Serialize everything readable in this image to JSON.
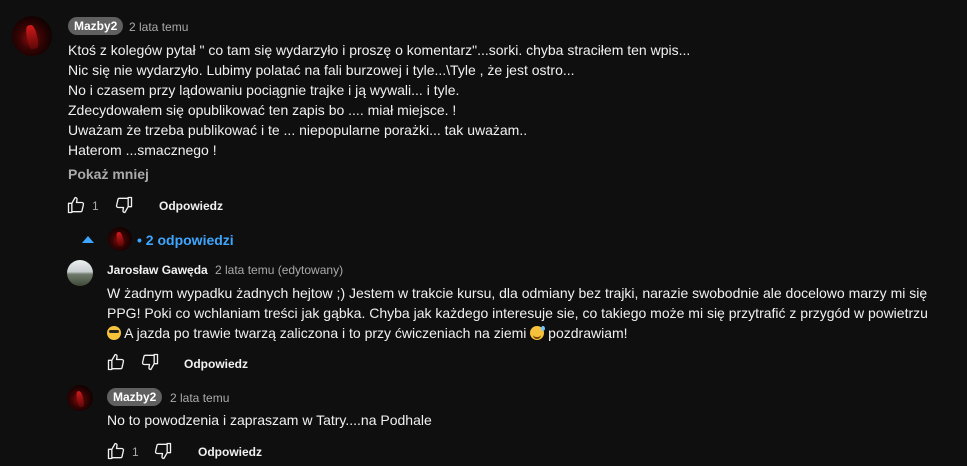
{
  "comment": {
    "author": "Mazby2",
    "time": "2 lata temu",
    "lines": [
      "Ktoś z kolegów pytał  \" co tam się wydarzyło i proszę o komentarz\"...sorki. chyba straciłem ten wpis...",
      "Nic się nie wydarzyło. Lubimy polatać na fali burzowej i tyle...\\Tyle , że jest ostro...",
      "No i czasem przy lądowaniu pociągnie trajke i ją wywali... i tyle.",
      "Zdecydowałem się opublikować ten zapis bo .... miał miejsce. !",
      "Uważam że trzeba publikować i te ... niepopularne porażki... tak uważam..",
      "Haterom ...smacznego !"
    ],
    "show_less": "Pokaż mniej",
    "likes": "1",
    "reply_label": "Odpowiedz"
  },
  "replies_toggle": {
    "label": "2 odpowiedzi",
    "bullet": "•"
  },
  "reply1": {
    "author": "Jarosław Gawęda",
    "time": "2 lata temu (edytowany)",
    "line1": "W żadnym wypadku żadnych hejtow ;) Jestem w trakcie kursu, dla odmiany bez trajki, narazie swobodnie ale docelowo marzy mi się",
    "line2": "PPG! Poki co wchlaniam treści jak gąbka. Chyba jak każdego interesuje sie, co takiego może mi się przytrafić z przygód w powietrzu",
    "line3_a": " A jazda po trawie twarzą zaliczona i to przy ćwiczeniach na ziemi ",
    "line3_b": "  pozdrawiam!",
    "reply_label": "Odpowiedz"
  },
  "reply2": {
    "author": "Mazby2",
    "time": "2 lata temu",
    "text": "No to powodzenia i zapraszam w Tatry....na Podhale",
    "likes": "1",
    "reply_label": "Odpowiedz"
  },
  "icons": {
    "like": "thumb-up-icon",
    "dislike": "thumb-down-icon",
    "caret": "caret-up-icon",
    "emoji1": "sunglasses-emoji",
    "emoji2": "sweat-smile-emoji"
  },
  "colors": {
    "background": "#0f0f0f",
    "text": "#f1f1f1",
    "secondary": "#aaaaaa",
    "link": "#3ea6ff",
    "badge": "#606060"
  }
}
